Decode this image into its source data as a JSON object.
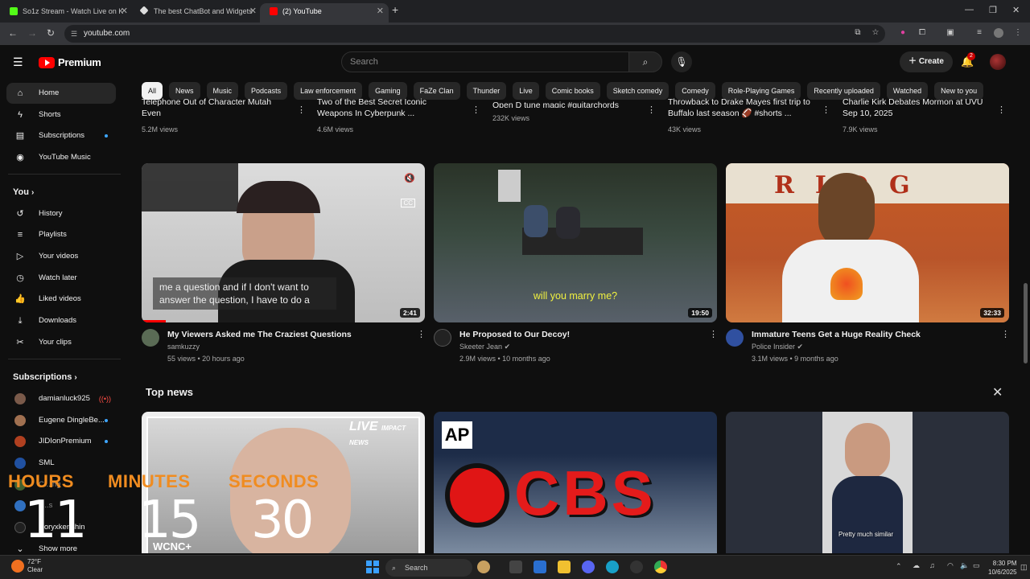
{
  "browser": {
    "tabs": [
      {
        "title": "So1z Stream - Watch Live on K",
        "favicon_color": "#53fc18"
      },
      {
        "title": "The best ChatBot and Widgets",
        "favicon_color": "#dddddd"
      },
      {
        "title": "(2) YouTube",
        "favicon_color": "#ff0000"
      }
    ],
    "new_tab": "+",
    "url": "youtube.com"
  },
  "header": {
    "brand": "Premium",
    "search_placeholder": "Search",
    "create_label": "Create",
    "notifications_count": "2"
  },
  "chips": [
    "All",
    "News",
    "Music",
    "Podcasts",
    "Law enforcement",
    "Gaming",
    "FaZe Clan",
    "Thunder",
    "Live",
    "Comic books",
    "Sketch comedy",
    "Comedy",
    "Role-Playing Games",
    "Recently uploaded",
    "Watched",
    "New to you"
  ],
  "sidebar": {
    "main": [
      {
        "label": "Home",
        "icon": "home-icon"
      },
      {
        "label": "Shorts",
        "icon": "shorts-icon"
      },
      {
        "label": "Subscriptions",
        "icon": "subscriptions-icon"
      },
      {
        "label": "YouTube Music",
        "icon": "music-icon"
      }
    ],
    "you_heading": "You",
    "you": [
      {
        "label": "History",
        "icon": "history-icon"
      },
      {
        "label": "Playlists",
        "icon": "playlists-icon"
      },
      {
        "label": "Your videos",
        "icon": "your-videos-icon"
      },
      {
        "label": "Watch later",
        "icon": "watch-later-icon"
      },
      {
        "label": "Liked videos",
        "icon": "liked-icon"
      },
      {
        "label": "Downloads",
        "icon": "downloads-icon"
      },
      {
        "label": "Your clips",
        "icon": "clips-icon"
      }
    ],
    "subs_heading": "Subscriptions",
    "subs": [
      {
        "label": "damianluck925",
        "color": "#7a5a4a"
      },
      {
        "label": "Eugene DingleBe...",
        "color": "#a07050"
      },
      {
        "label": "JIDIonPremium",
        "color": "#b04020"
      },
      {
        "label": "SML",
        "color": "#2050a0"
      },
      {
        "label": "C...ing",
        "color": "#406030"
      },
      {
        "label": "T...s",
        "color": "#3070c0"
      },
      {
        "label": "Coryxkenshin",
        "color": "#202020"
      }
    ],
    "show_more": "Show more"
  },
  "top_row": [
    {
      "title1": "Telephone Out of Character Mutah",
      "title2": "Even",
      "views": "5.2M views"
    },
    {
      "title1": "Two of the Best Secret Iconic",
      "title2": "Weapons In Cyberpunk ...",
      "views": "4.6M views"
    },
    {
      "title1": "Open D tune magic #guitarchords",
      "title2": "",
      "views": "232K views"
    },
    {
      "title1": "Throwback to Drake Mayes first trip to",
      "title2": "Buffalo last season 🏈 #shorts ...",
      "views": "43K views"
    },
    {
      "title1": "Charlie Kirk Debates Mormon at UVU",
      "title2": "Sep 10, 2025",
      "views": "7.9K views"
    }
  ],
  "videos": [
    {
      "title": "My Viewers Asked me The Craziest Questions",
      "channel": "samkuzzy",
      "stats": "55 views • 20 hours ago",
      "duration": "2:41",
      "caption": "me a question and if I don't want to answer the question, I have to do a"
    },
    {
      "title": "He Proposed to Our Decoy!",
      "channel": "Skeeter Jean",
      "stats": "2.9M views • 10 months ago",
      "duration": "19:50",
      "caption": "will you marry me?"
    },
    {
      "title": "Immature Teens Get a Huge Reality Check",
      "channel": "Police Insider",
      "stats": "3.1M views • 9 months ago",
      "duration": "32:33",
      "caption": ""
    }
  ],
  "top_news": {
    "heading": "Top news",
    "thumb1_badge": "LIVE",
    "thumb1_badge2": "IMPACT NEWS",
    "thumb1_brand": "WCNC+",
    "thumb2_badge": "AP",
    "thumb2_text": "CBS",
    "thumb3_caption": "Pretty much similar"
  },
  "countdown": {
    "hours_label": "HOURS",
    "minutes_label": "MINUTES",
    "seconds_label": "SECONDS",
    "hours": "11",
    "minutes": "15",
    "seconds": "30"
  },
  "taskbar": {
    "temp": "72°F",
    "weather": "Clear",
    "search": "Search",
    "time": "8:30 PM",
    "date": "10/6/2025"
  }
}
